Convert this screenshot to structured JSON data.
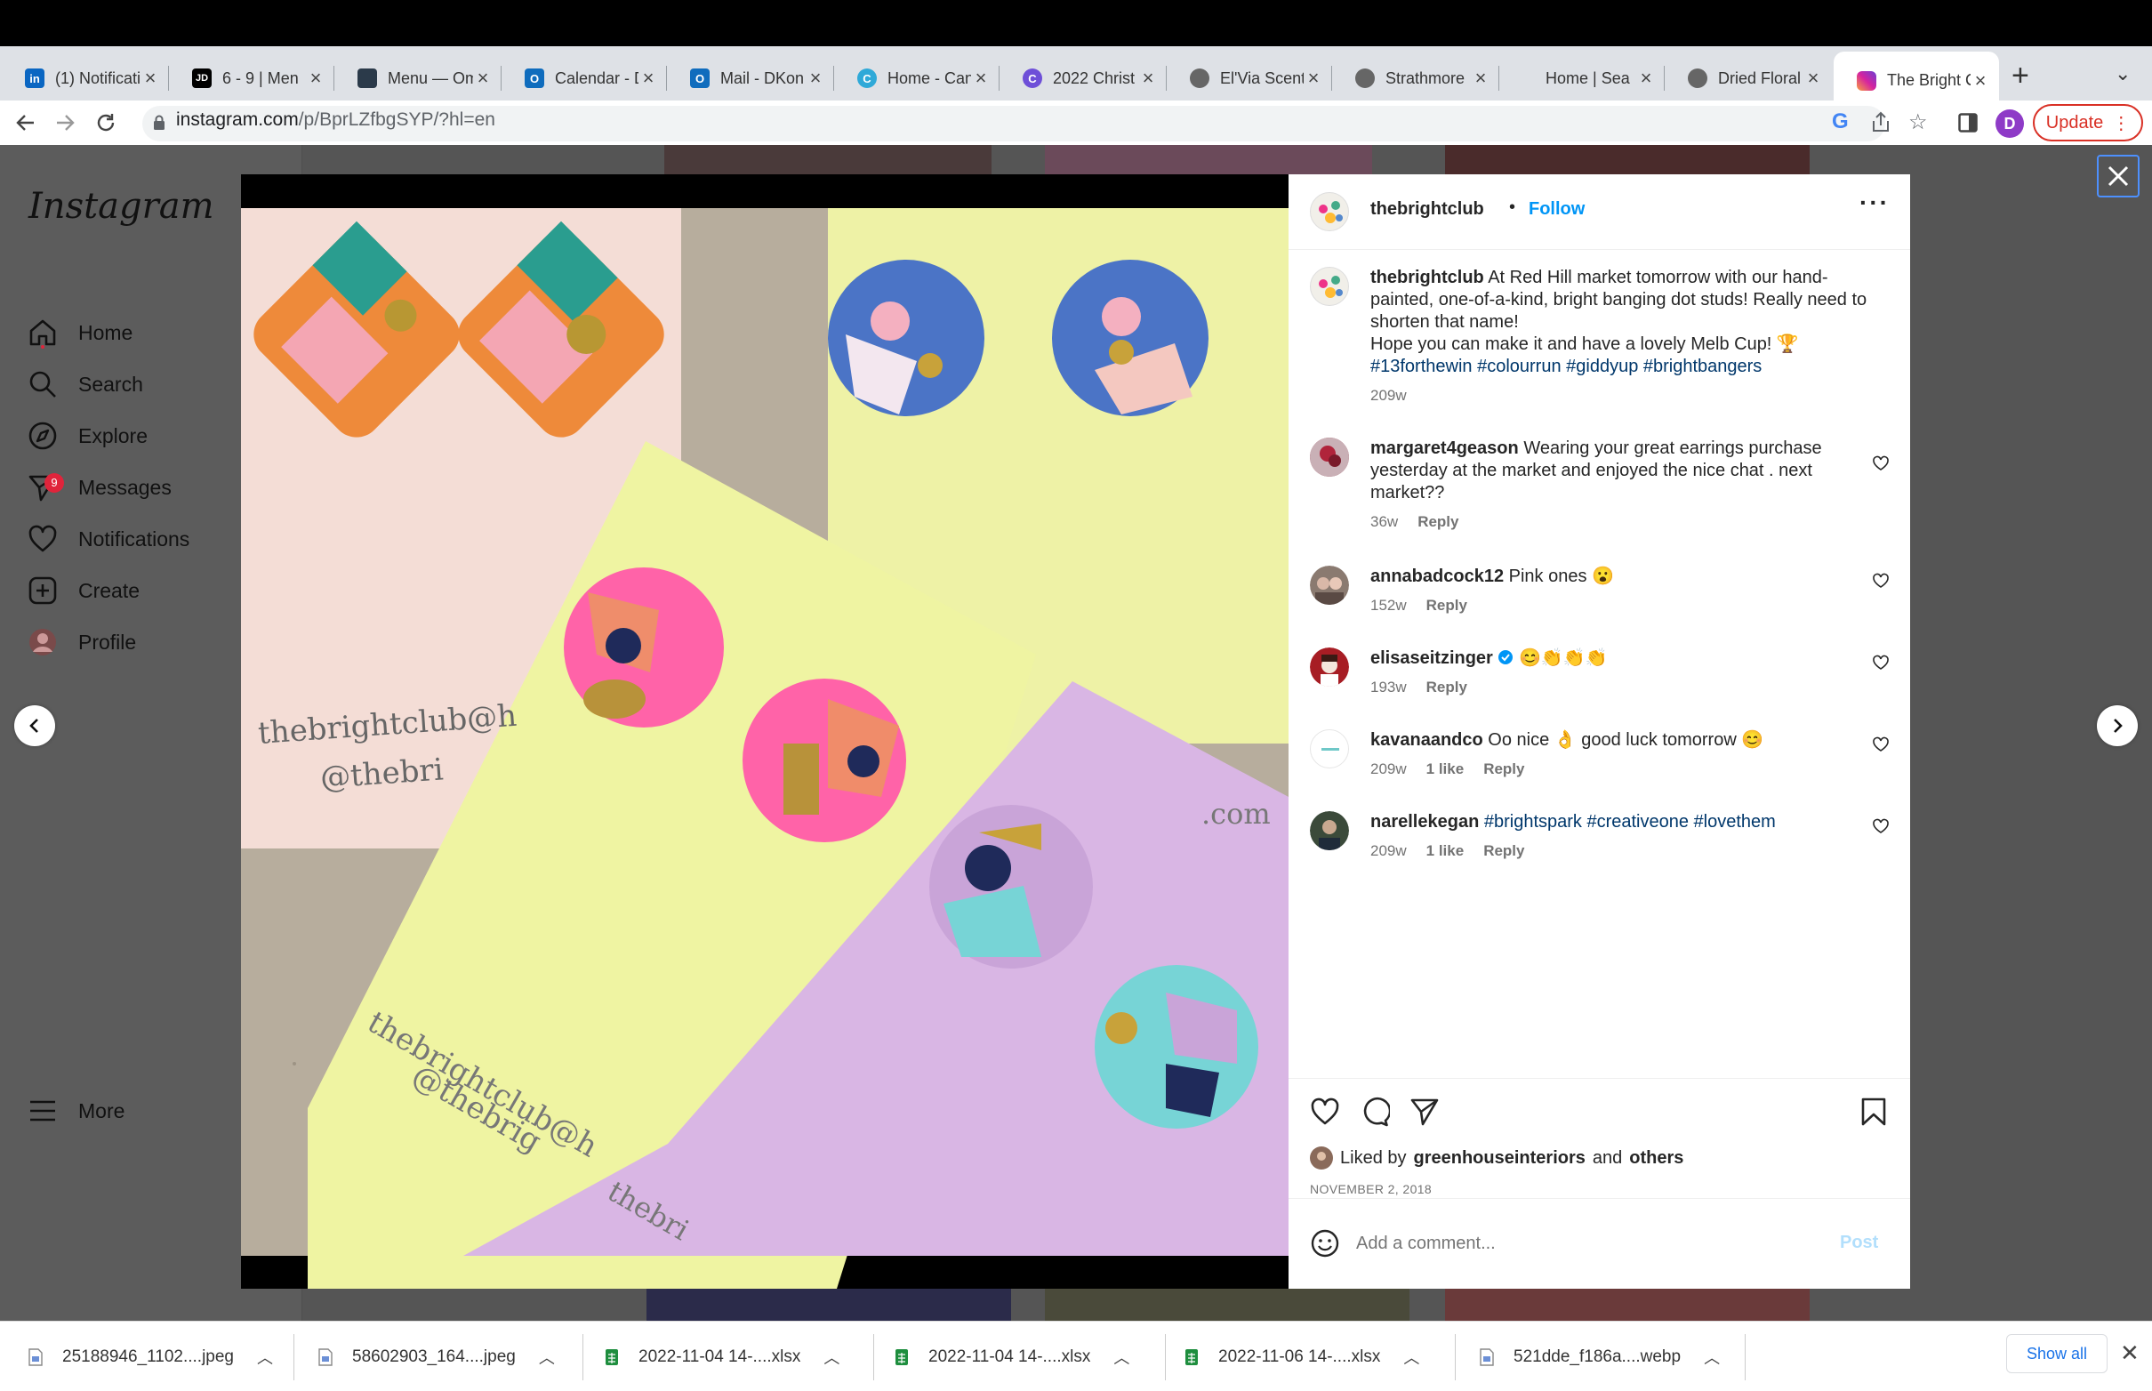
{
  "tabs": [
    {
      "label": "(1) Notificati",
      "favicon": "linkedin-icon",
      "color": "#0a66c2",
      "glyph": "in"
    },
    {
      "label": "6 - 9 | Men",
      "favicon": "jd-icon",
      "color": "#000000",
      "glyph": "JD"
    },
    {
      "label": "Menu — Om",
      "favicon": "page-icon",
      "color": "#2b3a4a",
      "glyph": ""
    },
    {
      "label": "Calendar - D",
      "favicon": "outlook-icon",
      "color": "#0f6cbd",
      "glyph": "O"
    },
    {
      "label": "Mail - DKon",
      "favicon": "outlook-icon",
      "color": "#0f6cbd",
      "glyph": "O"
    },
    {
      "label": "Home - Can",
      "favicon": "canva-icon",
      "color": "#2fa9d8",
      "glyph": "C"
    },
    {
      "label": "2022 Christ",
      "favicon": "canva-icon",
      "color": "#6e4fd8",
      "glyph": "C"
    },
    {
      "label": "El'Via Scent",
      "favicon": "globe-icon",
      "color": "#666666",
      "glyph": ""
    },
    {
      "label": "Strathmore",
      "favicon": "globe-icon",
      "color": "#666666",
      "glyph": ""
    },
    {
      "label": "Home | Sea",
      "favicon": "",
      "color": "",
      "glyph": ""
    },
    {
      "label": "Dried Floral",
      "favicon": "globe-icon",
      "color": "#666666",
      "glyph": ""
    },
    {
      "label": "The Bright C",
      "favicon": "instagram-icon",
      "color": "#d6249f",
      "glyph": ""
    }
  ],
  "address": {
    "host": "instagram.com",
    "path": "/p/BprLZfbgSYP/?hl=en"
  },
  "browser": {
    "update_label": "Update",
    "profile_initial": "D"
  },
  "sidebar": {
    "logo": "Instagram",
    "items": [
      {
        "label": "Home",
        "icon": "home-icon"
      },
      {
        "label": "Search",
        "icon": "search-icon"
      },
      {
        "label": "Explore",
        "icon": "compass-icon"
      },
      {
        "label": "Messages",
        "icon": "messenger-icon",
        "badge": "9"
      },
      {
        "label": "Notifications",
        "icon": "heart-icon"
      },
      {
        "label": "Create",
        "icon": "plus-square-icon"
      },
      {
        "label": "Profile",
        "icon": "avatar"
      }
    ],
    "more": "More"
  },
  "post": {
    "author": "thebrightclub",
    "follow": "Follow",
    "caption": "At Red Hill market tomorrow with our hand-painted, one-of-a-kind, bright banging dot studs! Really need to shorten that name!",
    "caption_line2": "Hope you can make it and have a lovely Melb Cup! 🏆",
    "hashtags": "#13forthewin #colourrun #giddyup #brightbangers",
    "time": "209w",
    "liked_by_prefix": "Liked by",
    "liked_by_user": "greenhouseinteriors",
    "liked_by_and": "and",
    "liked_by_others": "others",
    "date": "NOVEMBER 2, 2018",
    "add_comment_placeholder": "Add a comment...",
    "post_button": "Post"
  },
  "comments": [
    {
      "user": "margaret4geason",
      "text": "Wearing your great earrings purchase yesterday at the market and enjoyed the nice chat . next market??",
      "time": "36w",
      "likes": "",
      "reply": "Reply"
    },
    {
      "user": "annabadcock12",
      "text": "Pink ones 😮",
      "time": "152w",
      "likes": "",
      "reply": "Reply"
    },
    {
      "user": "elisaseitzinger",
      "text": "😊👏👏👏",
      "time": "193w",
      "likes": "",
      "reply": "Reply",
      "verified": true
    },
    {
      "user": "kavanaandco",
      "text": "Oo nice 👌 good luck tomorrow 😊",
      "time": "209w",
      "likes": "1 like",
      "reply": "Reply"
    },
    {
      "user": "narellekegan",
      "text": "#brightspark #creativeone #lovethem",
      "time": "209w",
      "likes": "1 like",
      "reply": "Reply",
      "hashtag_text": true
    }
  ],
  "downloads": [
    {
      "name": "25188946_1102....jpeg",
      "type": "image"
    },
    {
      "name": "58602903_164....jpeg",
      "type": "image"
    },
    {
      "name": "2022-11-04 14-....xlsx",
      "type": "sheet"
    },
    {
      "name": "2022-11-04 14-....xlsx",
      "type": "sheet"
    },
    {
      "name": "2022-11-06 14-....xlsx",
      "type": "sheet"
    },
    {
      "name": "521dde_f186a....webp",
      "type": "image"
    }
  ],
  "show_all": "Show all",
  "colors": {
    "accent": "#0095f6",
    "update": "#d93025",
    "hashtag": "#00376b"
  }
}
